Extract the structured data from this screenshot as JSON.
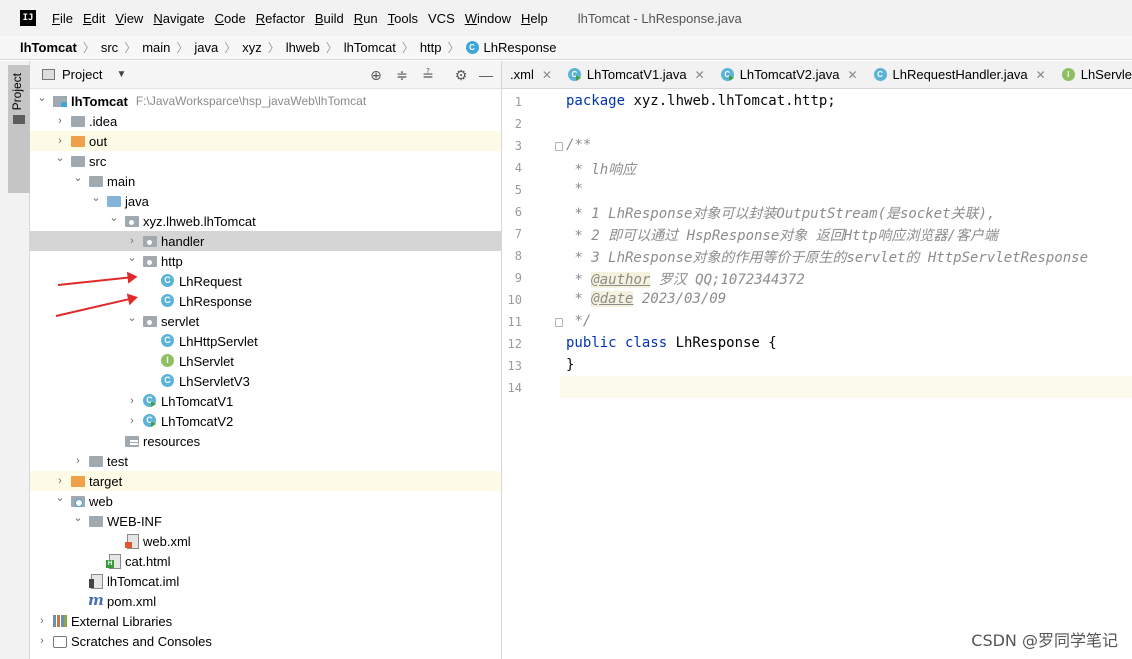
{
  "menubar": {
    "logo": "IJ",
    "items": [
      {
        "u": "F",
        "rest": "ile"
      },
      {
        "u": "E",
        "rest": "dit"
      },
      {
        "u": "V",
        "rest": "iew"
      },
      {
        "u": "N",
        "rest": "avigate"
      },
      {
        "u": "C",
        "rest": "ode"
      },
      {
        "u": "R",
        "rest": "efactor"
      },
      {
        "u": "B",
        "rest": "uild"
      },
      {
        "u": "R",
        "rest": "un"
      },
      {
        "u": "T",
        "rest": "ools"
      },
      {
        "u": "",
        "rest": "VCS"
      },
      {
        "u": "W",
        "rest": "indow"
      },
      {
        "u": "H",
        "rest": "elp"
      }
    ],
    "window_title": "lhTomcat - LhResponse.java"
  },
  "breadcrumb": [
    "lhTomcat",
    "src",
    "main",
    "java",
    "xyz",
    "lhweb",
    "lhTomcat",
    "http",
    "LhResponse"
  ],
  "stripe": {
    "label": "Project"
  },
  "project_panel": {
    "title": "Project",
    "tree": [
      {
        "name": "lhTomcat",
        "path": "F:\\JavaWorksparce\\hsp_javaWeb\\lhTomcat",
        "level": 0,
        "chev": "v",
        "icon": "root",
        "bold": true
      },
      {
        "name": ".idea",
        "level": 1,
        "chev": ">",
        "icon": "folder"
      },
      {
        "name": "out",
        "level": 1,
        "chev": ">",
        "icon": "folder orange",
        "bg": "yellow"
      },
      {
        "name": "src",
        "level": 1,
        "chev": "v",
        "icon": "folder"
      },
      {
        "name": "main",
        "level": 2,
        "chev": "v",
        "icon": "folder"
      },
      {
        "name": "java",
        "level": 3,
        "chev": "v",
        "icon": "folder blue"
      },
      {
        "name": "xyz.lhweb.lhTomcat",
        "level": 4,
        "chev": "v",
        "icon": "folder pkg"
      },
      {
        "name": "handler",
        "level": 5,
        "chev": ">",
        "icon": "folder pkg",
        "bg": "sel"
      },
      {
        "name": "http",
        "level": 5,
        "chev": "v",
        "icon": "folder pkg"
      },
      {
        "name": "LhRequest",
        "level": 6,
        "chev": "",
        "icon": "cls"
      },
      {
        "name": "LhResponse",
        "level": 6,
        "chev": "",
        "icon": "cls"
      },
      {
        "name": "servlet",
        "level": 5,
        "chev": "v",
        "icon": "folder pkg"
      },
      {
        "name": "LhHttpServlet",
        "level": 6,
        "chev": "",
        "icon": "cls"
      },
      {
        "name": "LhServlet",
        "level": 6,
        "chev": "",
        "icon": "iface"
      },
      {
        "name": "LhServletV3",
        "level": 6,
        "chev": "",
        "icon": "cls"
      },
      {
        "name": "LhTomcatV1",
        "level": 5,
        "chev": ">",
        "icon": "cls run"
      },
      {
        "name": "LhTomcatV2",
        "level": 5,
        "chev": ">",
        "icon": "cls run"
      },
      {
        "name": "resources",
        "level": 4,
        "chev": "",
        "icon": "folder res"
      },
      {
        "name": "test",
        "level": 2,
        "chev": ">",
        "icon": "folder"
      },
      {
        "name": "target",
        "level": 1,
        "chev": ">",
        "icon": "folder orange",
        "bg": "yellow"
      },
      {
        "name": "web",
        "level": 1,
        "chev": "v",
        "icon": "folder web"
      },
      {
        "name": "WEB-INF",
        "level": 2,
        "chev": "v",
        "icon": "folder"
      },
      {
        "name": "web.xml",
        "level": 4,
        "chev": "",
        "icon": "file xml"
      },
      {
        "name": "cat.html",
        "level": 3,
        "chev": "",
        "icon": "file html"
      },
      {
        "name": "lhTomcat.iml",
        "level": 2,
        "chev": "",
        "icon": "file iml"
      },
      {
        "name": "pom.xml",
        "level": 2,
        "chev": "",
        "icon": "maven"
      },
      {
        "name": "External Libraries",
        "level": 0,
        "chev": ">",
        "icon": "libs"
      },
      {
        "name": "Scratches and Consoles",
        "level": 0,
        "chev": ">",
        "icon": "scratch"
      }
    ]
  },
  "editor": {
    "tabs": [
      {
        "label": ".xml",
        "icon": ""
      },
      {
        "label": "LhTomcatV1.java",
        "icon": "c run"
      },
      {
        "label": "LhTomcatV2.java",
        "icon": "c run"
      },
      {
        "label": "LhRequestHandler.java",
        "icon": "c"
      },
      {
        "label": "LhServlet.java",
        "icon": "i"
      }
    ],
    "lines": [
      [
        [
          "kw",
          "package "
        ],
        [
          "pl",
          "xyz.lhweb.lhTomcat.http;"
        ]
      ],
      [],
      [
        [
          "cm",
          "/**"
        ]
      ],
      [
        [
          "cm",
          " * lh响应"
        ]
      ],
      [
        [
          "cm",
          " *"
        ]
      ],
      [
        [
          "cm",
          " * 1 LhResponse对象可以封装OutputStream(是socket关联),"
        ]
      ],
      [
        [
          "cm",
          " * 2 即可以通过 HspResponse对象 返回Http响应浏览器/客户端"
        ]
      ],
      [
        [
          "cm",
          " * 3 LhResponse对象的作用等价于原生的servlet的 HttpServletResponse"
        ]
      ],
      [
        [
          "cm",
          " * "
        ],
        [
          "tag",
          "@author"
        ],
        [
          "cm",
          " 罗汉 QQ;1072344372"
        ]
      ],
      [
        [
          "cm",
          " * "
        ],
        [
          "tag",
          "@date"
        ],
        [
          "cm",
          " 2023/03/09"
        ]
      ],
      [
        [
          "cm",
          " */"
        ]
      ],
      [
        [
          "kw",
          "public class "
        ],
        [
          "cls-name",
          "LhResponse "
        ],
        [
          "pl",
          "{"
        ]
      ],
      [
        [
          "pl",
          "}"
        ]
      ],
      []
    ],
    "current_line": 14
  },
  "watermark": "CSDN @罗同学笔记"
}
